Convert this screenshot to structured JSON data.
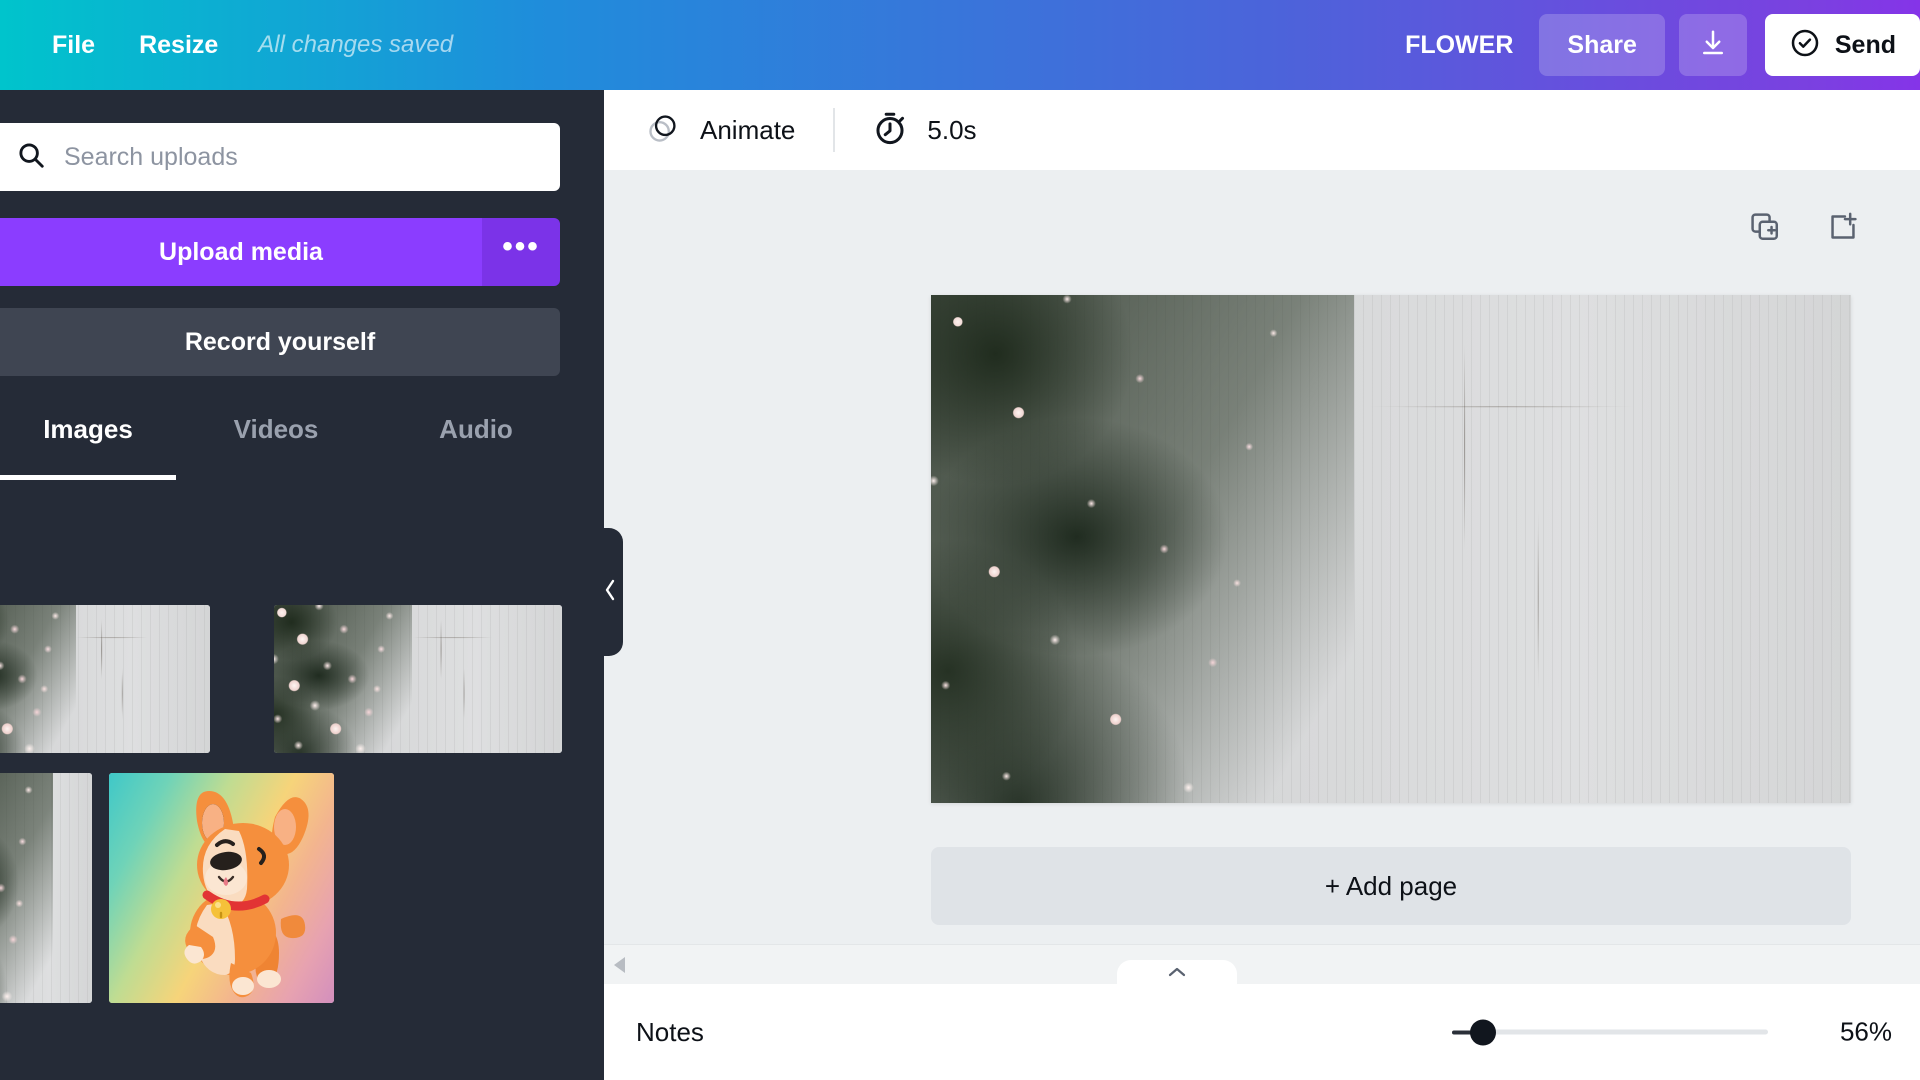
{
  "topbar": {
    "file_label": "File",
    "resize_label": "Resize",
    "save_status": "All changes saved",
    "design_title": "FLOWER",
    "share_label": "Share",
    "download_icon": "download-icon",
    "send_label": "Send",
    "send_icon": "check-circle-icon",
    "gradient_start": "#00c4cc",
    "gradient_end": "#8534e8"
  },
  "sidebar": {
    "search": {
      "placeholder": "Search uploads",
      "value": "",
      "icon": "search-icon"
    },
    "upload_label": "Upload media",
    "upload_more_label": "•••",
    "upload_color": "#8b3dff",
    "record_label": "Record yourself",
    "tabs": [
      {
        "label": "Images",
        "active": true
      },
      {
        "label": "Videos",
        "active": false
      },
      {
        "label": "Audio",
        "active": false
      }
    ],
    "thumbnails": [
      {
        "name": "flower-wall-thumb-1",
        "kind": "flowers"
      },
      {
        "name": "flower-wall-thumb-2",
        "kind": "flowers"
      },
      {
        "name": "flower-wall-thumb-3",
        "kind": "flowers"
      },
      {
        "name": "corgi-thumb-4",
        "kind": "corgi"
      }
    ],
    "collapse_icon": "chevron-left-icon",
    "background": "#252b37"
  },
  "editor": {
    "toolbar": {
      "animate_label": "Animate",
      "animate_icon": "animate-circles-icon",
      "timer_label": "5.0s",
      "timer_icon": "stopwatch-icon"
    },
    "page_actions": {
      "duplicate_icon": "duplicate-page-icon",
      "add_icon": "add-page-icon"
    },
    "canvas": {
      "name": "flower-wall-canvas-image"
    },
    "add_page_label": "+ Add page"
  },
  "bottombar": {
    "notes_label": "Notes",
    "expand_icon": "chevron-up-icon",
    "scroll_left_icon": "triangle-left-icon",
    "zoom_minus_icon": "minus-icon",
    "zoom_percent": "56%",
    "zoom_value": 56
  }
}
